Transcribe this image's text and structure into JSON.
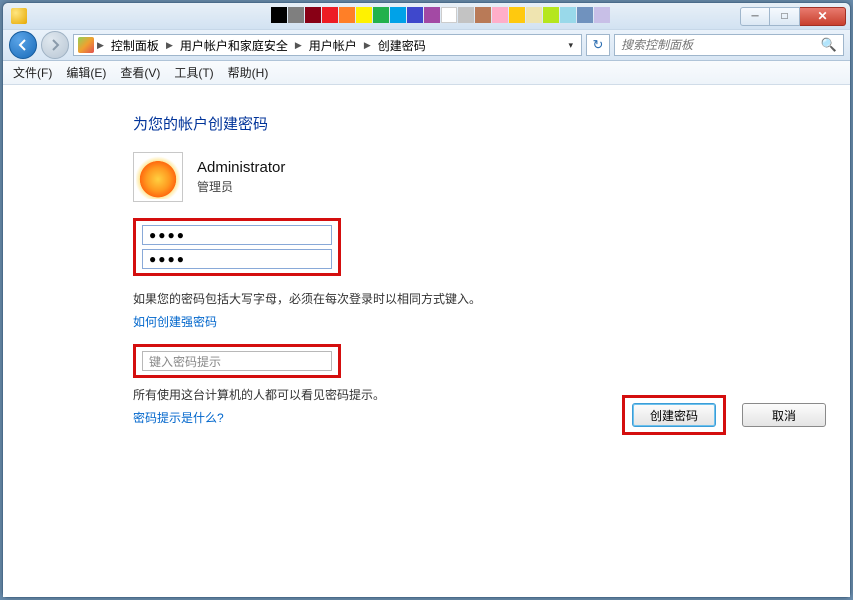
{
  "titlebar": {
    "min": "─",
    "max": "□",
    "close": "✕"
  },
  "nav": {
    "crumbs": [
      "控制面板",
      "用户帐户和家庭安全",
      "用户帐户",
      "创建密码"
    ]
  },
  "search": {
    "placeholder": "搜索控制面板"
  },
  "menu": {
    "file": "文件(F)",
    "edit": "编辑(E)",
    "view": "查看(V)",
    "tools": "工具(T)",
    "help": "帮助(H)"
  },
  "page": {
    "title": "为您的帐户创建密码",
    "username": "Administrator",
    "role": "管理员",
    "pw1": "●●●●",
    "pw2": "●●●●",
    "caps_note": "如果您的密码包括大写字母，必须在每次登录时以相同方式键入。",
    "link_strong": "如何创建强密码",
    "hint_placeholder": "键入密码提示",
    "hint_note": "所有使用这台计算机的人都可以看见密码提示。",
    "link_hint": "密码提示是什么?",
    "btn_create": "创建密码",
    "btn_cancel": "取消"
  }
}
